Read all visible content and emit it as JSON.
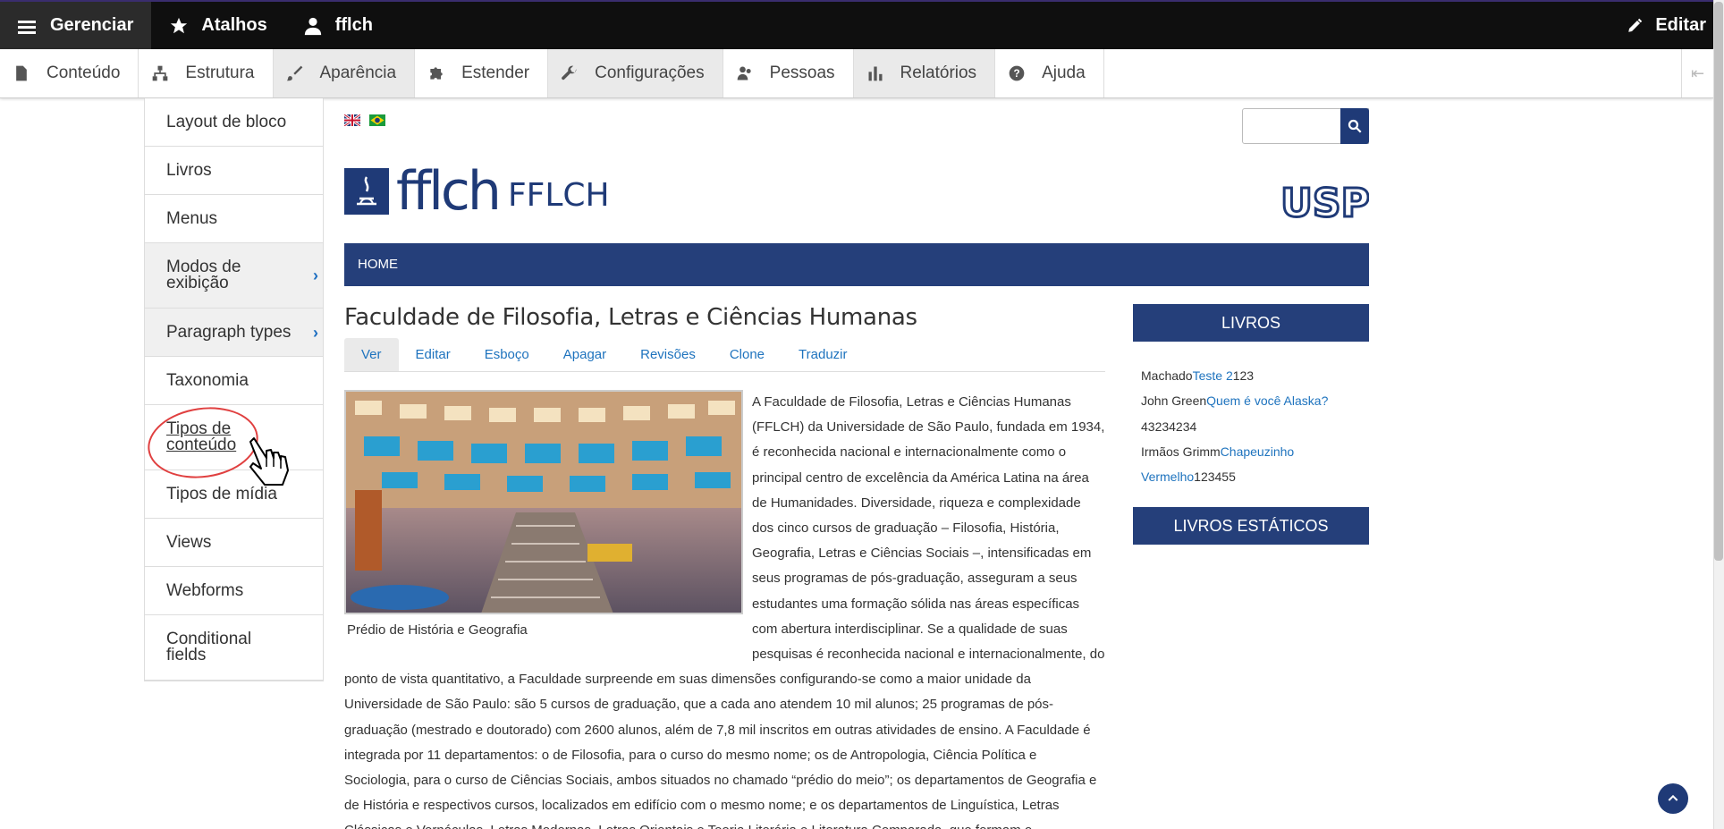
{
  "toolbar": {
    "manage_label": "Gerenciar",
    "shortcuts_label": "Atalhos",
    "user_label": "fflch",
    "edit_label": "Editar"
  },
  "tray": {
    "items": [
      {
        "label": "Conteúdo",
        "icon": "file-icon"
      },
      {
        "label": "Estrutura",
        "icon": "sitemap-icon"
      },
      {
        "label": "Aparência",
        "icon": "paintbrush-icon"
      },
      {
        "label": "Estender",
        "icon": "puzzle-icon"
      },
      {
        "label": "Configurações",
        "icon": "wrench-icon"
      },
      {
        "label": "Pessoas",
        "icon": "people-icon"
      },
      {
        "label": "Relatórios",
        "icon": "bar-chart-icon"
      },
      {
        "label": "Ajuda",
        "icon": "help-icon"
      }
    ]
  },
  "structure_menu": {
    "items": [
      {
        "label": "Layout de bloco"
      },
      {
        "label": "Livros"
      },
      {
        "label": "Menus"
      },
      {
        "label": "Modos de exibição"
      },
      {
        "label": "Paragraph types"
      },
      {
        "label": "Taxonomia"
      },
      {
        "label": "Tipos de conteúdo"
      },
      {
        "label": "Tipos de mídia"
      },
      {
        "label": "Views"
      },
      {
        "label": "Webforms"
      },
      {
        "label": "Conditional fields"
      }
    ]
  },
  "site": {
    "logo_text": "fflch",
    "logo_sub": "FFLCH",
    "usp_logo": "USP",
    "nav_home": "HOME"
  },
  "node": {
    "title": "Faculdade de Filosofia, Letras e Ciências Humanas",
    "tabs": [
      "Ver",
      "Editar",
      "Esboço",
      "Apagar",
      "Revisões",
      "Clone",
      "Traduzir"
    ],
    "image_caption": "Prédio de História e Geografia",
    "body": "A Faculdade de Filosofia, Letras e Ciências Humanas (FFLCH) da Universidade de São Paulo, fundada em 1934, é reconhecida nacional e internacionalmente como o principal centro de excelência da América Latina na área de Humanidades. Diversidade, riqueza e complexidade dos cinco cursos de graduação – Filosofia, História, Geografia, Letras e Ciências Sociais –, intensificadas em seus programas de pós-graduação, asseguram a seus estudantes uma formação sólida nas áreas específicas com abertura interdisciplinar. Se a qualidade de suas pesquisas é reconhecida nacional e internacionalmente, do ponto de vista quantitativo, a Faculdade surpreende em suas dimensões configurando-se como a maior unidade da Universidade de São Paulo: são 5 cursos de graduação, que a cada ano atendem 10 mil alunos; 25 programas de pós-graduação (mestrado e doutorado) com 2600 alunos, além de 7,8 mil inscritos em outras atividades de ensino. A Faculdade é integrada por 11 departamentos: o de Filosofia, para o curso do mesmo nome; os de Antropologia, Ciência Política e Sociologia, para o curso de Ciências Sociais, ambos situados no chamado “prédio do meio”; os departamentos de Geografia e de História e respectivos cursos, localizados em edifício com o mesmo nome; e os departamentos de Linguística, Letras Clássicas e Vernáculas, Letras Modernas, Letras Orientais e Teoria Literária e Literatura Comparada, que formam o"
  },
  "sidebar": {
    "books_heading": "LIVROS",
    "books": [
      {
        "author": "Machado",
        "title": "Teste 2",
        "number": "123"
      },
      {
        "author": "John Green",
        "title": "Quem é você Alaska?",
        "number": "43234234"
      },
      {
        "author": "Irmãos Grimm",
        "title": "Chapeuzinho Vermelho",
        "number": "123455"
      }
    ],
    "static_heading": "LIVROS ESTÁTICOS"
  },
  "colors": {
    "brand": "#253f7a",
    "link": "#1e73be",
    "annotation": "#e04040"
  }
}
